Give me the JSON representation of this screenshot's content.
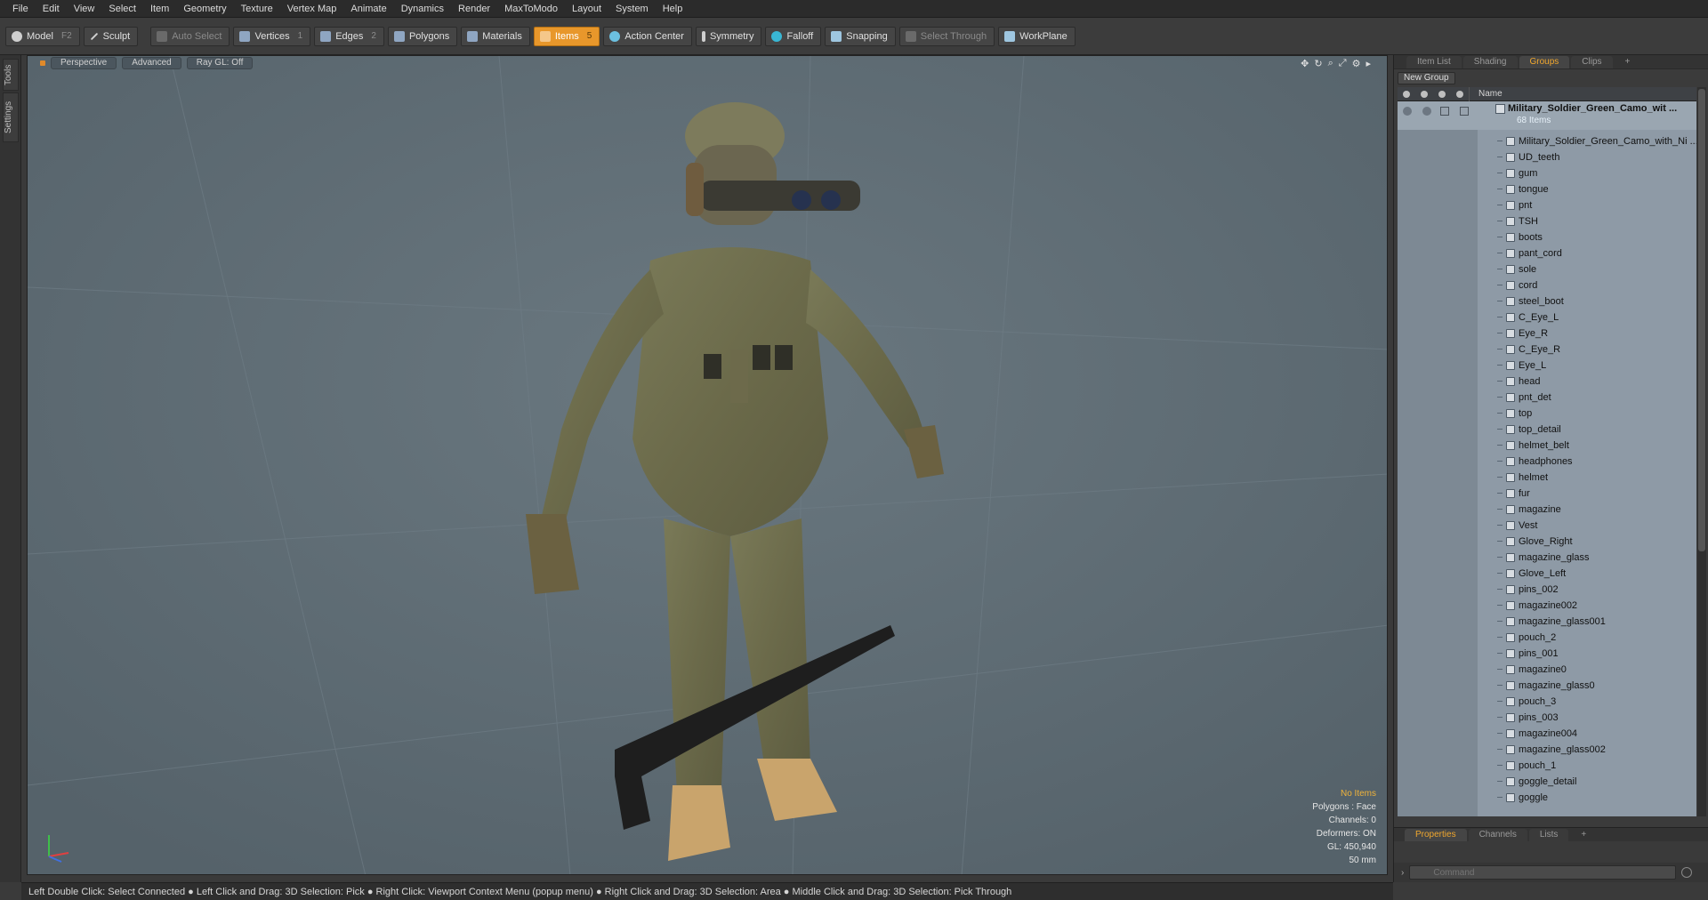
{
  "menu": [
    "File",
    "Edit",
    "View",
    "Select",
    "Item",
    "Geometry",
    "Texture",
    "Vertex Map",
    "Animate",
    "Dynamics",
    "Render",
    "MaxToModo",
    "Layout",
    "System",
    "Help"
  ],
  "toolbar": {
    "model": {
      "label": "Model",
      "key": "F2"
    },
    "sculpt": {
      "label": "Sculpt"
    },
    "auto_select": {
      "label": "Auto Select"
    },
    "vertices": {
      "label": "Vertices",
      "key": "1"
    },
    "edges": {
      "label": "Edges",
      "key": "2"
    },
    "polygons": {
      "label": "Polygons"
    },
    "materials": {
      "label": "Materials"
    },
    "items": {
      "label": "Items",
      "key": "5"
    },
    "action_center": {
      "label": "Action Center"
    },
    "symmetry": {
      "label": "Symmetry"
    },
    "falloff": {
      "label": "Falloff"
    },
    "snapping": {
      "label": "Snapping"
    },
    "select_through": {
      "label": "Select Through"
    },
    "workplane": {
      "label": "WorkPlane"
    }
  },
  "left_tabs": [
    "Tools",
    "Settings"
  ],
  "viewport": {
    "view": "Perspective",
    "mode": "Advanced",
    "raygl": "Ray GL: Off",
    "info": {
      "items": "No Items",
      "polygons": "Polygons : Face",
      "channels": "Channels: 0",
      "deformers": "Deformers: ON",
      "gl": "GL: 450,940",
      "lens": "50 mm"
    }
  },
  "right_panel": {
    "tabs": [
      "Item List",
      "Shading",
      "Groups",
      "Clips",
      "+"
    ],
    "active_tab": "Groups",
    "new_group": "New Group",
    "name_header": "Name",
    "group": {
      "name": "Military_Soldier_Green_Camo_wit ...",
      "count": "68 Items"
    },
    "items": [
      "Military_Soldier_Green_Camo_with_Ni ...",
      "UD_teeth",
      "gum",
      "tongue",
      "pnt",
      "TSH",
      "boots",
      "pant_cord",
      "sole",
      "cord",
      "steel_boot",
      "C_Eye_L",
      "Eye_R",
      "C_Eye_R",
      "Eye_L",
      "head",
      "pnt_det",
      "top",
      "top_detail",
      "helmet_belt",
      "headphones",
      "helmet",
      "fur",
      "magazine",
      "Vest",
      "Glove_Right",
      "magazine_glass",
      "Glove_Left",
      "pins_002",
      "magazine002",
      "magazine_glass001",
      "pouch_2",
      "pins_001",
      "magazine0",
      "magazine_glass0",
      "pouch_3",
      "pins_003",
      "magazine004",
      "magazine_glass002",
      "pouch_1",
      "goggle_detail",
      "goggle"
    ],
    "prop_tabs": [
      "Properties",
      "Channels",
      "Lists",
      "+"
    ],
    "command_placeholder": "Command"
  },
  "status": "Left Double Click: Select Connected ● Left Click and Drag: 3D Selection: Pick ● Right Click: Viewport Context Menu (popup menu) ● Right Click and Drag: 3D Selection: Area ● Middle Click and Drag: 3D Selection: Pick Through"
}
